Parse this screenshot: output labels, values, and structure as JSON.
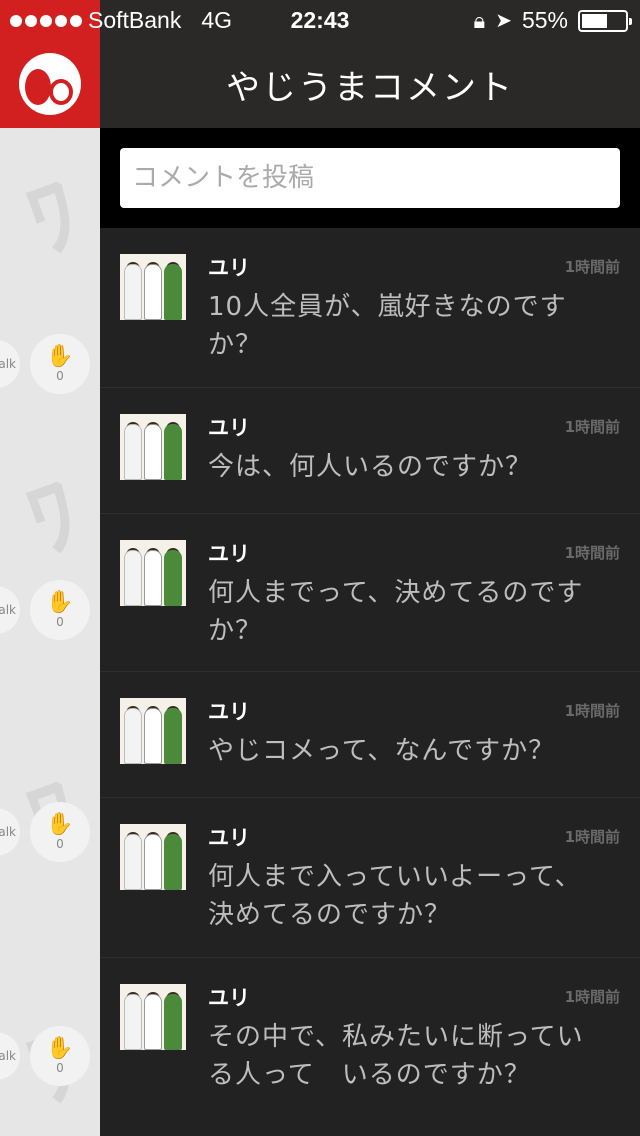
{
  "status_bar": {
    "carrier": "SoftBank",
    "network": "4G",
    "time": "22:43",
    "battery": "55%"
  },
  "header": {
    "title": "やじうまコメント"
  },
  "input": {
    "placeholder": "コメントを投稿"
  },
  "side_items": [
    {
      "talk": "alk",
      "count": "0"
    },
    {
      "talk": "alk",
      "count": "0"
    },
    {
      "talk": "alk",
      "count": "0"
    },
    {
      "talk": "alk",
      "count": "0"
    }
  ],
  "comments": [
    {
      "user": "ユリ",
      "time": "1時間前",
      "line1": "10人全員が、嵐好きなのです",
      "line2": "か？"
    },
    {
      "user": "ユリ",
      "time": "1時間前",
      "line1": "今は、何人いるのですか？",
      "line2": ""
    },
    {
      "user": "ユリ",
      "time": "1時間前",
      "line1": "何人までって、決めてるのです",
      "line2": "か？"
    },
    {
      "user": "ユリ",
      "time": "1時間前",
      "line1": "やじコメって、なんですか？",
      "line2": ""
    },
    {
      "user": "ユリ",
      "time": "1時間前",
      "line1": "何人まで入っていいよーって、",
      "line2": "決めてるのですか？"
    },
    {
      "user": "ユリ",
      "time": "1時間前",
      "line1": "その中で、私みたいに断ってい",
      "line2": "る人って　いるのですか？"
    }
  ],
  "colors": {
    "brand_red": "#d21f1f",
    "header_bg": "#2b2828",
    "list_bg": "#222222"
  }
}
